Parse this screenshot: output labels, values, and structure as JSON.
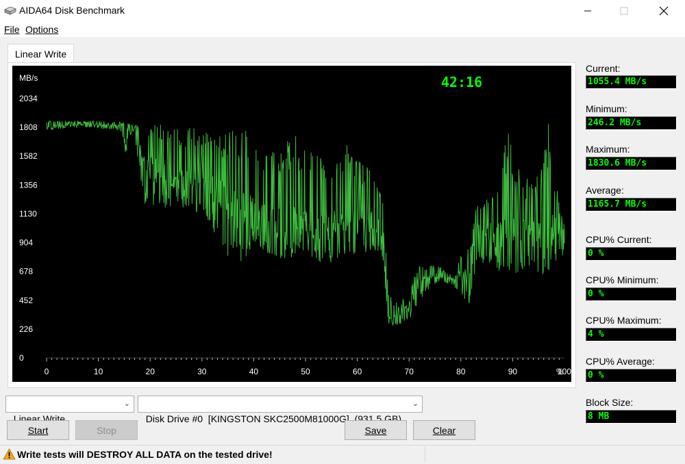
{
  "window": {
    "title": "AIDA64 Disk Benchmark",
    "icon": "disk-drive-icon",
    "controls": {
      "minimize": "—",
      "maximize": "☐",
      "close": "✕"
    }
  },
  "menu": {
    "file": "File",
    "options": "Options"
  },
  "tabs": [
    {
      "label": "Linear Write",
      "active": true
    }
  ],
  "timer": "42:16",
  "colors": {
    "graph_line": "#3dbb3d",
    "timer": "#00ff00",
    "stat_text": "#00ff00",
    "chart_bg": "#000000",
    "warning": "#f5a623"
  },
  "stats": {
    "current": {
      "label": "Current:",
      "value": "1055.4 MB/s"
    },
    "minimum": {
      "label": "Minimum:",
      "value": "246.2 MB/s"
    },
    "maximum": {
      "label": "Maximum:",
      "value": "1830.6 MB/s"
    },
    "average": {
      "label": "Average:",
      "value": "1165.7 MB/s"
    },
    "cpu_current": {
      "label": "CPU% Current:",
      "value": "0 %"
    },
    "cpu_minimum": {
      "label": "CPU% Minimum:",
      "value": "0 %"
    },
    "cpu_maximum": {
      "label": "CPU% Maximum:",
      "value": "4 %"
    },
    "cpu_average": {
      "label": "CPU% Average:",
      "value": "0 %"
    },
    "block_size": {
      "label": "Block Size:",
      "value": "8 MB"
    }
  },
  "controls": {
    "test_select": "Linear Write",
    "drive_select": "Disk Drive #0  [KINGSTON SKC2500M81000G]  (931.5 GB)",
    "start": "Start",
    "stop": "Stop",
    "save": "Save",
    "clear": "Clear"
  },
  "status": {
    "warning": "Write tests will DESTROY ALL DATA on the tested drive!"
  },
  "chart_data": {
    "type": "line",
    "ylabel": "MB/s",
    "xlabel": "",
    "xunit": "%",
    "y_ticks": [
      0,
      226,
      452,
      678,
      904,
      1130,
      1356,
      1582,
      1808,
      2034
    ],
    "x_ticks": [
      0,
      10,
      20,
      30,
      40,
      50,
      60,
      70,
      80,
      90,
      100
    ],
    "ylim": [
      0,
      2034
    ],
    "xlim": [
      0,
      100
    ],
    "grid": true,
    "series": [
      {
        "values_mode": "envelope",
        "points": [
          {
            "x": 0,
            "y": 1800,
            "lo": 1780,
            "hi": 1860
          },
          {
            "x": 5,
            "y": 1830,
            "lo": 1810,
            "hi": 1860
          },
          {
            "x": 10,
            "y": 1830,
            "lo": 1800,
            "hi": 1860
          },
          {
            "x": 14,
            "y": 1820,
            "lo": 1780,
            "hi": 1850
          },
          {
            "x": 15,
            "y": 1700,
            "lo": 1550,
            "hi": 1840
          },
          {
            "x": 17,
            "y": 1810,
            "lo": 1700,
            "hi": 1840
          },
          {
            "x": 19,
            "y": 1500,
            "lo": 1200,
            "hi": 1820
          },
          {
            "x": 22,
            "y": 1450,
            "lo": 1180,
            "hi": 1830
          },
          {
            "x": 25,
            "y": 1400,
            "lo": 1180,
            "hi": 1820
          },
          {
            "x": 28,
            "y": 1400,
            "lo": 1180,
            "hi": 1800
          },
          {
            "x": 30,
            "y": 1450,
            "lo": 1100,
            "hi": 1800
          },
          {
            "x": 33,
            "y": 1300,
            "lo": 950,
            "hi": 1750
          },
          {
            "x": 35,
            "y": 1200,
            "lo": 800,
            "hi": 1820
          },
          {
            "x": 38,
            "y": 1150,
            "lo": 750,
            "hi": 1780
          },
          {
            "x": 40,
            "y": 1150,
            "lo": 900,
            "hi": 1800
          },
          {
            "x": 43,
            "y": 1100,
            "lo": 800,
            "hi": 1600
          },
          {
            "x": 45,
            "y": 1050,
            "lo": 750,
            "hi": 1650
          },
          {
            "x": 48,
            "y": 1100,
            "lo": 800,
            "hi": 1750
          },
          {
            "x": 50,
            "y": 1050,
            "lo": 800,
            "hi": 1650
          },
          {
            "x": 53,
            "y": 1000,
            "lo": 750,
            "hi": 1600
          },
          {
            "x": 55,
            "y": 1050,
            "lo": 750,
            "hi": 1500
          },
          {
            "x": 58,
            "y": 1100,
            "lo": 800,
            "hi": 1700
          },
          {
            "x": 60,
            "y": 1050,
            "lo": 800,
            "hi": 1550
          },
          {
            "x": 63,
            "y": 1100,
            "lo": 850,
            "hi": 1500
          },
          {
            "x": 65,
            "y": 1000,
            "lo": 750,
            "hi": 1300
          },
          {
            "x": 66,
            "y": 300,
            "lo": 250,
            "hi": 500
          },
          {
            "x": 68,
            "y": 330,
            "lo": 260,
            "hi": 420
          },
          {
            "x": 70,
            "y": 400,
            "lo": 300,
            "hi": 580
          },
          {
            "x": 72,
            "y": 600,
            "lo": 450,
            "hi": 720
          },
          {
            "x": 74,
            "y": 650,
            "lo": 550,
            "hi": 730
          },
          {
            "x": 76,
            "y": 640,
            "lo": 590,
            "hi": 720
          },
          {
            "x": 78,
            "y": 620,
            "lo": 580,
            "hi": 660
          },
          {
            "x": 80,
            "y": 650,
            "lo": 500,
            "hi": 800
          },
          {
            "x": 82,
            "y": 700,
            "lo": 400,
            "hi": 900
          },
          {
            "x": 83,
            "y": 1000,
            "lo": 750,
            "hi": 1200
          },
          {
            "x": 85,
            "y": 1000,
            "lo": 700,
            "hi": 1250
          },
          {
            "x": 87,
            "y": 950,
            "lo": 700,
            "hi": 1300
          },
          {
            "x": 89,
            "y": 1000,
            "lo": 600,
            "hi": 1800
          },
          {
            "x": 91,
            "y": 950,
            "lo": 650,
            "hi": 1500
          },
          {
            "x": 93,
            "y": 1000,
            "lo": 700,
            "hi": 1400
          },
          {
            "x": 95,
            "y": 950,
            "lo": 650,
            "hi": 1500
          },
          {
            "x": 97,
            "y": 1000,
            "lo": 650,
            "hi": 1850
          },
          {
            "x": 99,
            "y": 1000,
            "lo": 800,
            "hi": 1200
          },
          {
            "x": 100,
            "y": 1055,
            "lo": 800,
            "hi": 1100
          }
        ]
      }
    ]
  }
}
